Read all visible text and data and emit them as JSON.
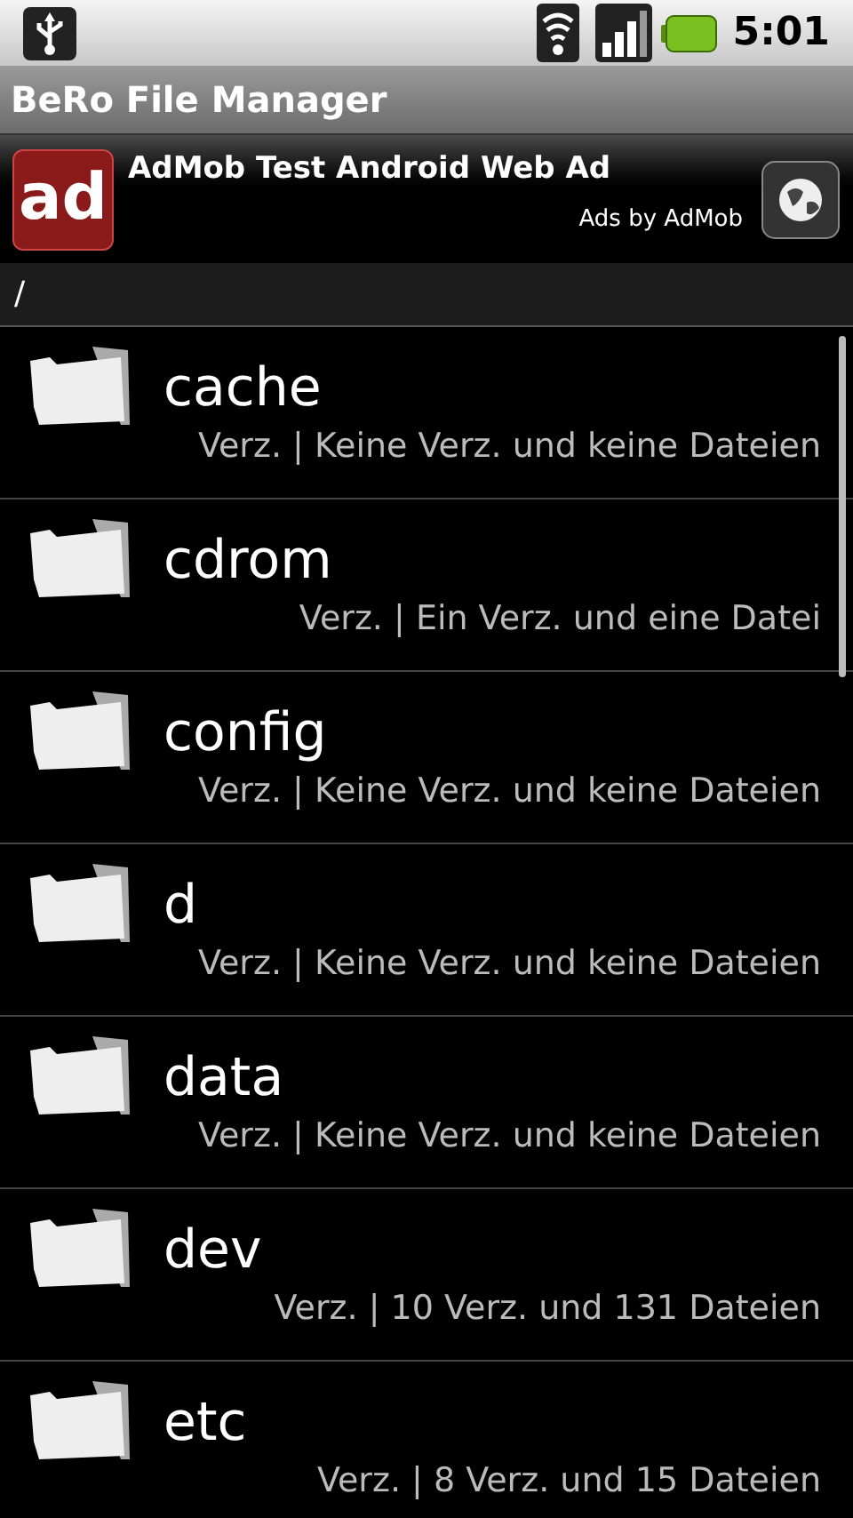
{
  "status_bar": {
    "time": "5:01"
  },
  "title_bar": {
    "title": "BeRo File Manager"
  },
  "ad_banner": {
    "logo": "ad",
    "title": "AdMob Test Android Web Ad",
    "subtitle": "Ads by AdMob"
  },
  "path_bar": {
    "path": "/"
  },
  "files": [
    {
      "name": "cache",
      "details": "Verz. | Keine Verz. und keine Dateien"
    },
    {
      "name": "cdrom",
      "details": "Verz. | Ein Verz. und eine Datei"
    },
    {
      "name": "config",
      "details": "Verz. | Keine Verz. und keine Dateien"
    },
    {
      "name": "d",
      "details": "Verz. | Keine Verz. und keine Dateien"
    },
    {
      "name": "data",
      "details": "Verz. | Keine Verz. und keine Dateien"
    },
    {
      "name": "dev",
      "details": "Verz. | 10 Verz. und 131 Dateien"
    },
    {
      "name": "etc",
      "details": "Verz. | 8 Verz. und 15 Dateien"
    }
  ]
}
